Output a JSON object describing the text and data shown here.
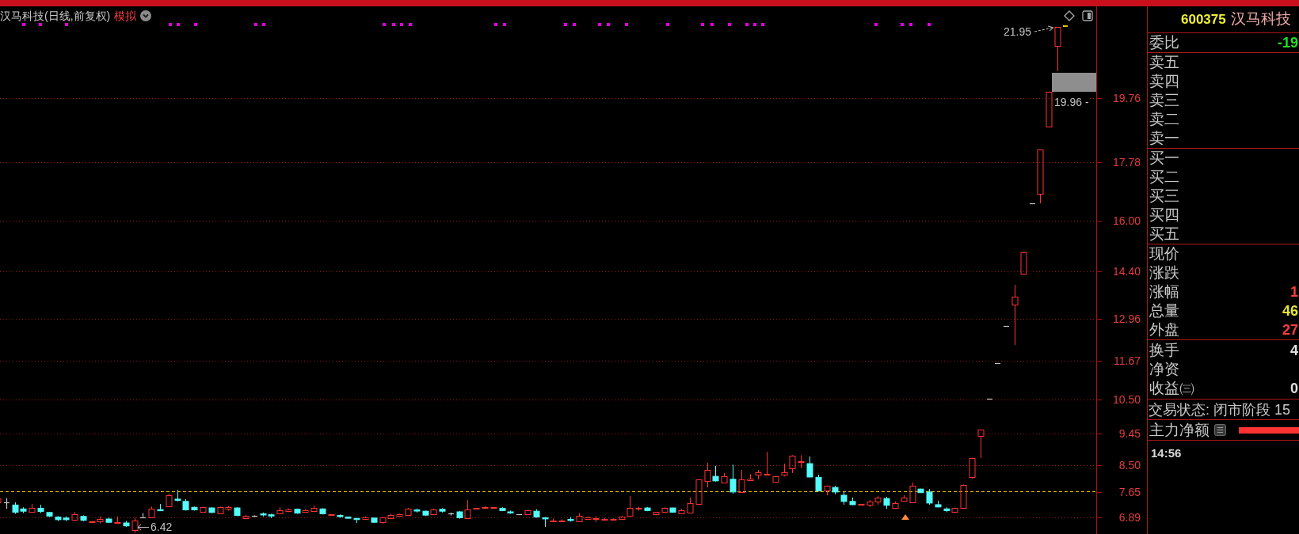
{
  "chart_header": {
    "title": "汉马科技(日线,前复权)",
    "mode": "模拟"
  },
  "price_chart": {
    "axis_labels": [
      "19.76",
      "17.78",
      "16.00",
      "14.40",
      "12.96",
      "11.67",
      "10.50",
      "9.45",
      "8.50",
      "7.65",
      "6.89"
    ],
    "high_label": "21.95",
    "cursor_label": "19.96 -",
    "low_label": "6.42"
  },
  "quote_panel": {
    "code": "600375",
    "name": "汉马科技",
    "order_ratio": {
      "label": "委比",
      "value": "-19"
    },
    "ask_levels": [
      "卖五",
      "卖四",
      "卖三",
      "卖二",
      "卖一"
    ],
    "bid_levels": [
      "买一",
      "买二",
      "买三",
      "买四",
      "买五"
    ],
    "price_stats": [
      {
        "label": "现价"
      },
      {
        "label": "涨跌"
      },
      {
        "label": "涨幅",
        "value": "1",
        "color": "#ff3c3c"
      },
      {
        "label": "总量",
        "value": "46",
        "color": "#e6e632"
      },
      {
        "label": "外盘",
        "value": "27",
        "color": "#ff3c3c"
      }
    ],
    "share_stats": [
      {
        "label": "换手",
        "value": "4",
        "color": "#e0e0e0"
      },
      {
        "label": "净资"
      },
      {
        "label": "收益㈢",
        "value": "0",
        "color": "#e0e0e0"
      }
    ],
    "trading_status": "交易状态: 闭市阶段 15",
    "main_net": {
      "label": "主力净额"
    },
    "time": "14:56"
  }
}
